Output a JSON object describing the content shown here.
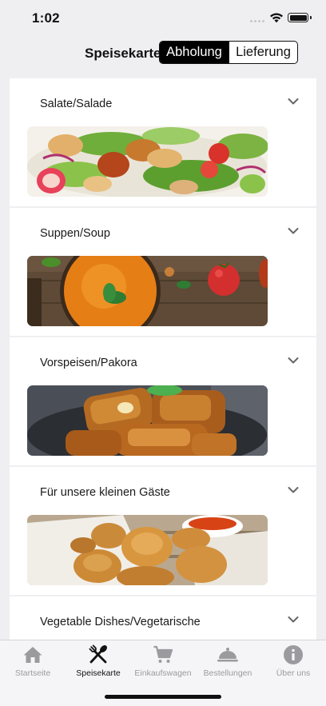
{
  "status_bar": {
    "time": "1:02"
  },
  "header": {
    "title": "Speisekarte",
    "segments": [
      {
        "label": "Abholung",
        "selected": true
      },
      {
        "label": "Lieferung",
        "selected": false
      }
    ]
  },
  "categories": [
    {
      "title": "Salate/Salade",
      "icon": "chevron-down-icon",
      "image": "salad-image"
    },
    {
      "title": "Suppen/Soup",
      "icon": "chevron-down-icon",
      "image": "soup-image"
    },
    {
      "title": "Vorspeisen/Pakora",
      "icon": "chevron-down-icon",
      "image": "pakora-image"
    },
    {
      "title": "Für unsere kleinen Gäste",
      "icon": "chevron-down-icon",
      "image": "nuggets-image"
    },
    {
      "title": "Vegetable Dishes/Vegetarische",
      "icon": "chevron-down-icon",
      "image": ""
    }
  ],
  "tabbar": {
    "tabs": [
      {
        "label": "Startseite",
        "icon": "home-icon",
        "active": false
      },
      {
        "label": "Speisekarte",
        "icon": "cutlery-icon",
        "active": true
      },
      {
        "label": "Einkaufswagen",
        "icon": "cart-icon",
        "active": false
      },
      {
        "label": "Bestellungen",
        "icon": "cloche-icon",
        "active": false
      },
      {
        "label": "Über uns",
        "icon": "info-icon",
        "active": false
      }
    ]
  },
  "colors": {
    "active": "#111111",
    "inactive": "#9b9b9f",
    "background": "#efeff1"
  }
}
